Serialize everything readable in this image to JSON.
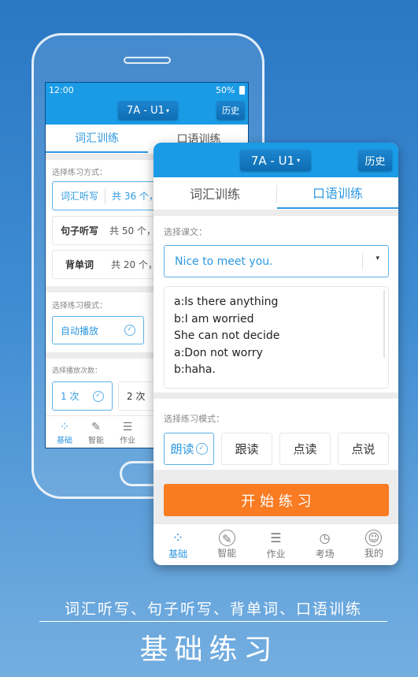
{
  "colors": {
    "accent": "#2d98e0",
    "header": "#1a9be6",
    "start_button": "#f97b22"
  },
  "back_screen": {
    "status": {
      "time": "12:00",
      "battery": "50%"
    },
    "unit_selector": "7A - U1",
    "history": "历史",
    "tabs": [
      "词汇训练",
      "口语训练"
    ],
    "method_label": "选择练习方式：",
    "methods": [
      {
        "name": "词汇听写",
        "info": "共 36 个，"
      },
      {
        "name": "句子听写",
        "info": "共 50 个，"
      },
      {
        "name": "背单词",
        "info": "共 20 个，"
      }
    ],
    "mode_label": "选择练习模式：",
    "mode": "自动播放",
    "count_label": "选择播放次数：",
    "counts": [
      "1 次",
      "2 次"
    ],
    "nav": [
      "基础",
      "智能",
      "作业"
    ]
  },
  "front_screen": {
    "unit_selector": "7A - U1",
    "history": "历史",
    "tabs": [
      "词汇训练",
      "口语训练"
    ],
    "text_label": "选择课文：",
    "selected_text": "Nice to meet you.",
    "dialogue": [
      "a:Is there anything",
      "b:I am worried",
      "She can not decide",
      "a:Don not worry",
      "b:haha."
    ],
    "mode_label": "选择练习模式：",
    "modes": [
      "朗读",
      "跟读",
      "点读",
      "点说"
    ],
    "start": "开 始 练 习",
    "nav": [
      {
        "label": "基础",
        "icon": "grid-icon"
      },
      {
        "label": "智能",
        "icon": "pencil-circle-icon"
      },
      {
        "label": "作业",
        "icon": "clipboard-icon"
      },
      {
        "label": "考场",
        "icon": "clock-camera-icon"
      },
      {
        "label": "我的",
        "icon": "user-icon"
      }
    ]
  },
  "caption": {
    "subtitle": "词汇听写、句子听写、背单词、口语训练",
    "title": "基础练习"
  }
}
